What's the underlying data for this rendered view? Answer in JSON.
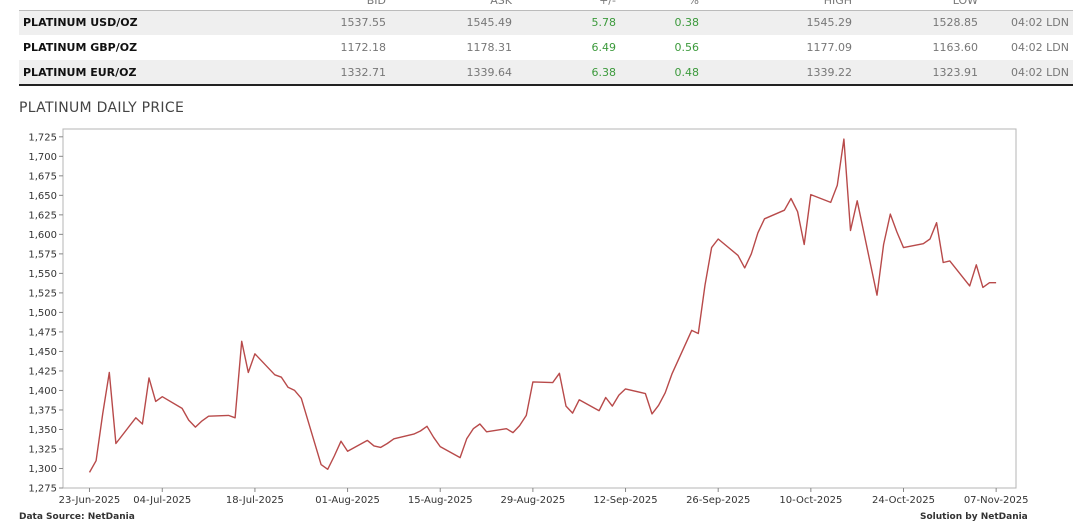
{
  "table": {
    "columns": [
      "BID",
      "ASK",
      "+/-",
      "%",
      "HIGH",
      "LOW"
    ],
    "rows": [
      {
        "instrument": "PLATINUM USD/OZ",
        "bid": "1537.55",
        "ask": "1545.49",
        "change": "5.78",
        "pct": "0.38",
        "high": "1545.29",
        "low": "1528.85",
        "time": "04:02 LDN"
      },
      {
        "instrument": "PLATINUM GBP/OZ",
        "bid": "1172.18",
        "ask": "1178.31",
        "change": "6.49",
        "pct": "0.56",
        "high": "1177.09",
        "low": "1163.60",
        "time": "04:02 LDN"
      },
      {
        "instrument": "PLATINUM EUR/OZ",
        "bid": "1332.71",
        "ask": "1339.64",
        "change": "6.38",
        "pct": "0.48",
        "high": "1339.22",
        "low": "1323.91",
        "time": "04:02 LDN"
      }
    ],
    "change_color": "#3c9a3c"
  },
  "chart_title": "PLATINUM DAILY PRICE",
  "chart_data": {
    "type": "line",
    "title": "PLATINUM DAILY PRICE",
    "xlabel": "",
    "ylabel": "",
    "ylim": [
      1275,
      1735
    ],
    "grid": false,
    "line_color": "#b84a4a",
    "y_ticks": [
      1275,
      1300,
      1325,
      1350,
      1375,
      1400,
      1425,
      1450,
      1475,
      1500,
      1525,
      1550,
      1575,
      1600,
      1625,
      1650,
      1675,
      1700,
      1725
    ],
    "y_tick_labels": [
      "1,275",
      "1,300",
      "1,325",
      "1,350",
      "1,375",
      "1,400",
      "1,425",
      "1,450",
      "1,475",
      "1,500",
      "1,525",
      "1,550",
      "1,575",
      "1,600",
      "1,625",
      "1,650",
      "1,675",
      "1,700",
      "1,725"
    ],
    "x_ticks": [
      "23-Jun-2025",
      "04-Jul-2025",
      "18-Jul-2025",
      "01-Aug-2025",
      "15-Aug-2025",
      "29-Aug-2025",
      "12-Sep-2025",
      "26-Sep-2025",
      "10-Oct-2025",
      "24-Oct-2025",
      "07-Nov-2025"
    ],
    "x": [
      "2025-06-23",
      "2025-06-24",
      "2025-06-25",
      "2025-06-26",
      "2025-06-27",
      "2025-06-30",
      "2025-07-01",
      "2025-07-02",
      "2025-07-03",
      "2025-07-04",
      "2025-07-07",
      "2025-07-08",
      "2025-07-09",
      "2025-07-10",
      "2025-07-11",
      "2025-07-14",
      "2025-07-15",
      "2025-07-16",
      "2025-07-17",
      "2025-07-18",
      "2025-07-21",
      "2025-07-22",
      "2025-07-23",
      "2025-07-24",
      "2025-07-25",
      "2025-07-28",
      "2025-07-29",
      "2025-07-30",
      "2025-07-31",
      "2025-08-01",
      "2025-08-04",
      "2025-08-05",
      "2025-08-06",
      "2025-08-07",
      "2025-08-08",
      "2025-08-11",
      "2025-08-12",
      "2025-08-13",
      "2025-08-14",
      "2025-08-15",
      "2025-08-18",
      "2025-08-19",
      "2025-08-20",
      "2025-08-21",
      "2025-08-22",
      "2025-08-25",
      "2025-08-26",
      "2025-08-27",
      "2025-08-28",
      "2025-08-29",
      "2025-09-01",
      "2025-09-02",
      "2025-09-03",
      "2025-09-04",
      "2025-09-05",
      "2025-09-08",
      "2025-09-09",
      "2025-09-10",
      "2025-09-11",
      "2025-09-12",
      "2025-09-15",
      "2025-09-16",
      "2025-09-17",
      "2025-09-18",
      "2025-09-19",
      "2025-09-22",
      "2025-09-23",
      "2025-09-24",
      "2025-09-25",
      "2025-09-26",
      "2025-09-29",
      "2025-09-30",
      "2025-10-01",
      "2025-10-02",
      "2025-10-03",
      "2025-10-06",
      "2025-10-07",
      "2025-10-08",
      "2025-10-09",
      "2025-10-10",
      "2025-10-13",
      "2025-10-14",
      "2025-10-15",
      "2025-10-16",
      "2025-10-17",
      "2025-10-20",
      "2025-10-21",
      "2025-10-22",
      "2025-10-23",
      "2025-10-24",
      "2025-10-27",
      "2025-10-28",
      "2025-10-29",
      "2025-10-30",
      "2025-10-31",
      "2025-11-03",
      "2025-11-04",
      "2025-11-05",
      "2025-11-06",
      "2025-11-07"
    ],
    "series": [
      {
        "values": [
          1295,
          1310,
          1370,
          1423,
          1332,
          1365,
          1357,
          1416,
          1386,
          1392,
          1377,
          1362,
          1353,
          1361,
          1367,
          1368,
          1365,
          1463,
          1423,
          1447,
          1420,
          1417,
          1404,
          1400,
          1390,
          1305,
          1299,
          1316,
          1335,
          1322,
          1336,
          1329,
          1327,
          1332,
          1338,
          1344,
          1348,
          1354,
          1340,
          1328,
          1314,
          1338,
          1351,
          1357,
          1347,
          1351,
          1346,
          1355,
          1368,
          1411,
          1410,
          1422,
          1380,
          1371,
          1388,
          1374,
          1391,
          1380,
          1394,
          1402,
          1396,
          1370,
          1381,
          1397,
          1421,
          1477,
          1473,
          1535,
          1583,
          1594,
          1573,
          1557,
          1575,
          1602,
          1620,
          1631,
          1646,
          1629,
          1587,
          1651,
          1641,
          1663,
          1722,
          1605,
          1643,
          1522,
          1587,
          1626,
          1603,
          1583,
          1588,
          1594,
          1615,
          1564,
          1566,
          1534,
          1561,
          1532,
          1538,
          1538
        ]
      }
    ]
  },
  "footer": {
    "source": "Data Source: NetDania",
    "solution": "Solution by NetDania"
  }
}
